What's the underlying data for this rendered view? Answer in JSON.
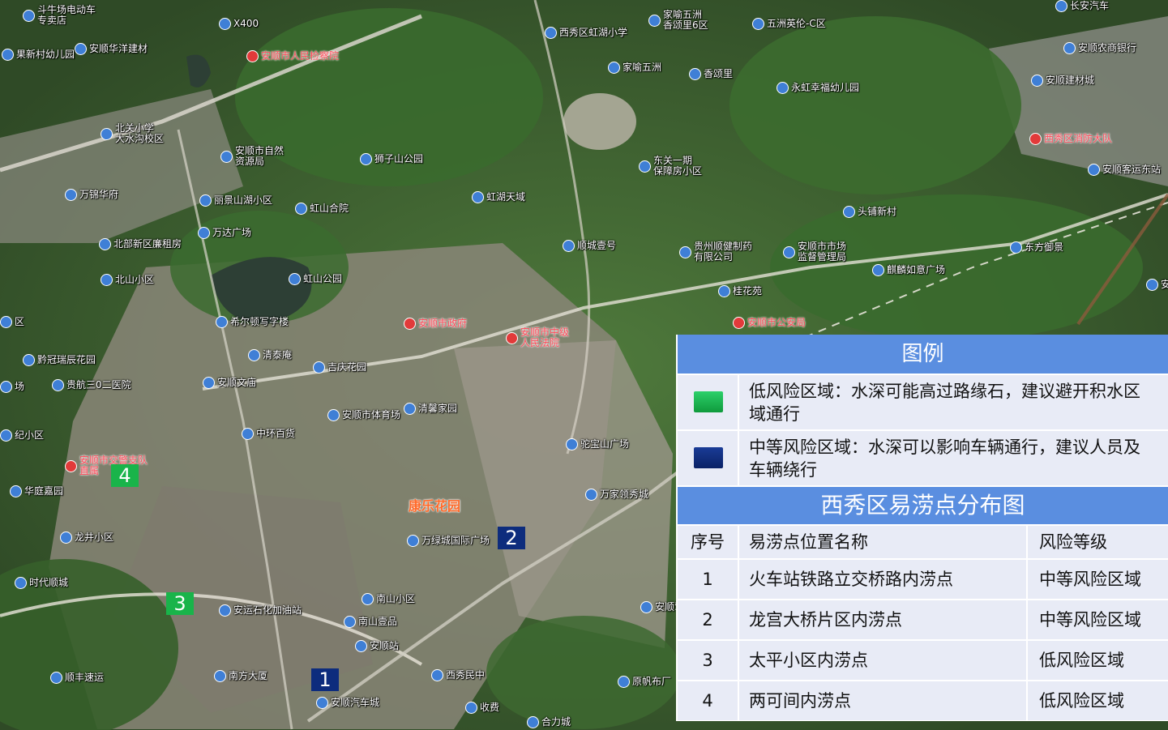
{
  "map": {
    "pois": [
      {
        "id": "p1",
        "label": "斗牛场电动车\n专卖店",
        "style": "poi"
      },
      {
        "id": "p2",
        "label": "安顺华洋建材",
        "style": "poi"
      },
      {
        "id": "p3",
        "label": "果新村幼儿园",
        "style": "poi"
      },
      {
        "id": "p4",
        "label": "安顺市人民检察院",
        "style": "red"
      },
      {
        "id": "p5",
        "label": "西秀区虹湖小学",
        "style": "poi"
      },
      {
        "id": "p6",
        "label": "家喻五洲\n香颂里6区",
        "style": "poi"
      },
      {
        "id": "p7",
        "label": "五洲英伦-C区",
        "style": "poi"
      },
      {
        "id": "p8",
        "label": "长安汽车",
        "style": "poi"
      },
      {
        "id": "p9",
        "label": "安顺农商银行",
        "style": "poi"
      },
      {
        "id": "p10",
        "label": "家喻五洲",
        "style": "poi"
      },
      {
        "id": "p11",
        "label": "香颂里",
        "style": "poi"
      },
      {
        "id": "p12",
        "label": "永虹幸福幼儿园",
        "style": "poi"
      },
      {
        "id": "p13",
        "label": "安顺建材城",
        "style": "poi"
      },
      {
        "id": "p14",
        "label": "北关小学\n大水沟校区",
        "style": "poi"
      },
      {
        "id": "p15",
        "label": "安顺市自然\n资源局",
        "style": "poi"
      },
      {
        "id": "p16",
        "label": "西秀区消防大队",
        "style": "red"
      },
      {
        "id": "p17",
        "label": "狮子山公园",
        "style": "poi"
      },
      {
        "id": "p18",
        "label": "东关一期\n保障房小区",
        "style": "poi"
      },
      {
        "id": "p19",
        "label": "安顺客运东站",
        "style": "poi"
      },
      {
        "id": "p20",
        "label": "万锦华府",
        "style": "poi"
      },
      {
        "id": "p21",
        "label": "丽景山湖小区",
        "style": "poi"
      },
      {
        "id": "p22",
        "label": "虹湖天域",
        "style": "poi"
      },
      {
        "id": "p23",
        "label": "虹山合院",
        "style": "poi"
      },
      {
        "id": "p24",
        "label": "头铺新村",
        "style": "poi"
      },
      {
        "id": "p25",
        "label": "万达广场",
        "style": "poi"
      },
      {
        "id": "p26",
        "label": "北部新区廉租房",
        "style": "poi"
      },
      {
        "id": "p27",
        "label": "顺城壹号",
        "style": "poi"
      },
      {
        "id": "p28",
        "label": "安顺市市场\n监督管理局",
        "style": "poi"
      },
      {
        "id": "p29",
        "label": "东方御景",
        "style": "poi"
      },
      {
        "id": "p30",
        "label": "北山小区",
        "style": "poi"
      },
      {
        "id": "p31",
        "label": "虹山公园",
        "style": "poi"
      },
      {
        "id": "p32",
        "label": "贵州顺健制药\n有限公司",
        "style": "poi"
      },
      {
        "id": "p33",
        "label": "麒麟如意广场",
        "style": "poi"
      },
      {
        "id": "p34",
        "label": "安大",
        "style": "poi"
      },
      {
        "id": "p35",
        "label": "桂花苑",
        "style": "poi"
      },
      {
        "id": "p36",
        "label": "希尔顿写字楼",
        "style": "poi"
      },
      {
        "id": "p37",
        "label": "安顺市政府",
        "style": "red"
      },
      {
        "id": "p38",
        "label": "安顺市中级\n人民法院",
        "style": "red"
      },
      {
        "id": "p39",
        "label": "安顺市公安局",
        "style": "red"
      },
      {
        "id": "p40",
        "label": "黔冠瑞辰花园",
        "style": "poi"
      },
      {
        "id": "p41",
        "label": "清泰庵",
        "style": "poi"
      },
      {
        "id": "p42",
        "label": "吉庆花园",
        "style": "poi"
      },
      {
        "id": "p43",
        "label": "贵航三0二医院",
        "style": "poi"
      },
      {
        "id": "p44",
        "label": "安顺文庙",
        "style": "poi"
      },
      {
        "id": "p45",
        "label": "安顺市体育场",
        "style": "poi"
      },
      {
        "id": "p46",
        "label": "清馨家园",
        "style": "poi"
      },
      {
        "id": "p47",
        "label": "中环百货",
        "style": "poi"
      },
      {
        "id": "p48",
        "label": "驼宝山广场",
        "style": "poi"
      },
      {
        "id": "p49",
        "label": "安顺市交警支队\n直属",
        "style": "red"
      },
      {
        "id": "p50",
        "label": "华庭嘉园",
        "style": "poi"
      },
      {
        "id": "p51",
        "label": "万家领秀城",
        "style": "poi"
      },
      {
        "id": "p52",
        "label": "康乐花园",
        "style": "orange"
      },
      {
        "id": "p53",
        "label": "龙井小区",
        "style": "poi"
      },
      {
        "id": "p54",
        "label": "万绿城国际广场",
        "style": "poi"
      },
      {
        "id": "p55",
        "label": "时代顺城",
        "style": "poi"
      },
      {
        "id": "p56",
        "label": "安运石化加油站",
        "style": "poi"
      },
      {
        "id": "p57",
        "label": "南山小区",
        "style": "poi"
      },
      {
        "id": "p58",
        "label": "安顺驾校",
        "style": "poi"
      },
      {
        "id": "p59",
        "label": "南山壹品",
        "style": "poi"
      },
      {
        "id": "p60",
        "label": "安顺站",
        "style": "poi"
      },
      {
        "id": "p61",
        "label": "顺丰速运",
        "style": "poi"
      },
      {
        "id": "p62",
        "label": "南方大厦",
        "style": "poi"
      },
      {
        "id": "p63",
        "label": "西秀民中",
        "style": "poi"
      },
      {
        "id": "p64",
        "label": "原帆布厂",
        "style": "poi"
      },
      {
        "id": "p65",
        "label": "安顺汽车城",
        "style": "poi"
      },
      {
        "id": "p66",
        "label": "区",
        "style": "poi"
      },
      {
        "id": "p67",
        "label": "场",
        "style": "poi"
      },
      {
        "id": "p68",
        "label": "纪小区",
        "style": "poi"
      },
      {
        "id": "p69",
        "label": "合力城",
        "style": "poi"
      },
      {
        "id": "p70",
        "label": "收费",
        "style": "poi"
      },
      {
        "id": "p71",
        "label": "X400",
        "style": "poi"
      }
    ],
    "markers": [
      {
        "num": "1",
        "risk": "mid"
      },
      {
        "num": "2",
        "risk": "mid"
      },
      {
        "num": "3",
        "risk": "low"
      },
      {
        "num": "4",
        "risk": "low"
      }
    ]
  },
  "legend": {
    "title": "图例",
    "items": [
      {
        "color": "#12b04a",
        "text": "低风险区域：水深可能高过路缘石，建议避开积水区域通行"
      },
      {
        "color": "#0d2c7d",
        "text": "中等风险区域：水深可以影响车辆通行，建议人员及车辆绕行"
      }
    ],
    "table_title": "西秀区易涝点分布图",
    "table_headers": [
      "序号",
      "易涝点位置名称",
      "风险等级"
    ],
    "table_rows": [
      [
        "1",
        "火车站铁路立交桥路内涝点",
        "中等风险区域"
      ],
      [
        "2",
        "龙宫大桥片区内涝点",
        "中等风险区域"
      ],
      [
        "3",
        "太平小区内涝点",
        "低风险区域"
      ],
      [
        "4",
        "两可间内涝点",
        "低风险区域"
      ]
    ]
  },
  "colors": {
    "legend_header": "#5a8ee0",
    "legend_row_bg": "#e8ebf6",
    "low_risk": "#19b44a",
    "mid_risk": "#0d2c7d"
  }
}
